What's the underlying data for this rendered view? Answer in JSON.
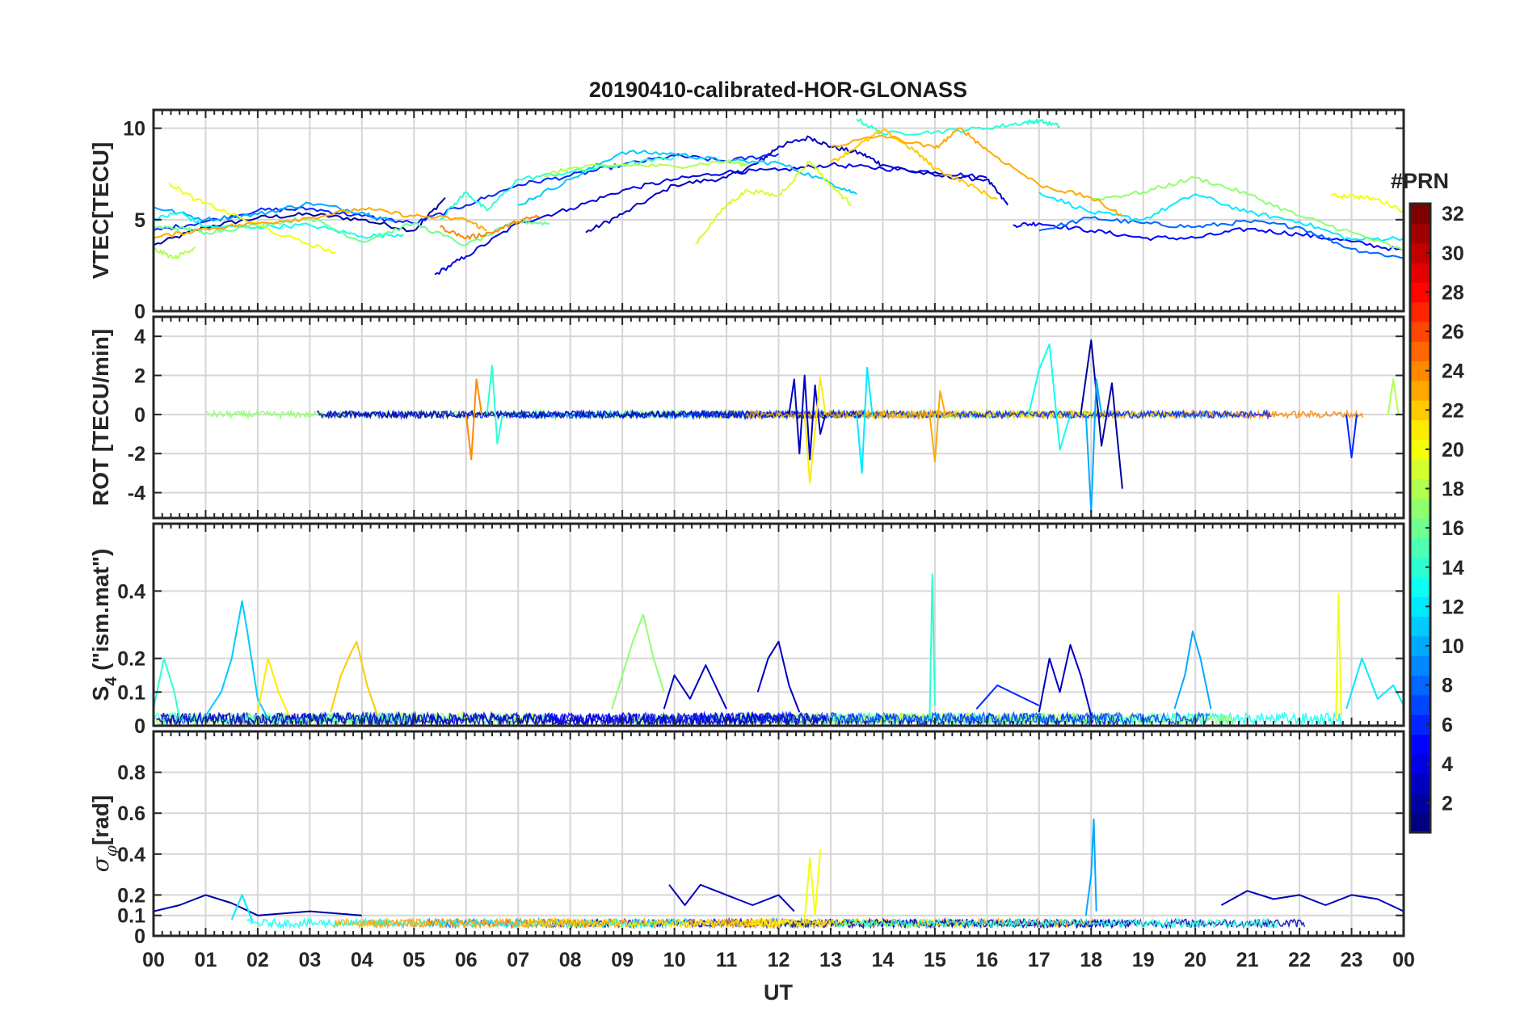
{
  "figure": {
    "title": "20190410-calibrated-HOR-GLONASS",
    "xlabel": "UT",
    "x_tick_labels": [
      "00",
      "01",
      "02",
      "03",
      "04",
      "05",
      "06",
      "07",
      "08",
      "09",
      "10",
      "11",
      "12",
      "13",
      "14",
      "15",
      "16",
      "17",
      "18",
      "19",
      "20",
      "21",
      "22",
      "23",
      "00"
    ]
  },
  "colorbar": {
    "title": "#PRN",
    "range": [
      1,
      32
    ],
    "colormap": "jet",
    "tick_values": [
      2,
      4,
      6,
      8,
      10,
      12,
      14,
      16,
      18,
      20,
      22,
      24,
      26,
      28,
      30,
      32
    ],
    "tick_labels": [
      "2",
      "4",
      "6",
      "8",
      "10",
      "12",
      "14",
      "16",
      "18",
      "20",
      "22",
      "24",
      "26",
      "28",
      "30",
      "32"
    ]
  },
  "chart_data": [
    {
      "type": "line",
      "panel": "vtec",
      "ylabel": "VTEC[TECU]",
      "xlim": [
        0,
        24
      ],
      "ylim": [
        0,
        11
      ],
      "y_ticks": [
        0,
        5,
        10
      ],
      "y_tick_labels": [
        "0",
        "5",
        "10"
      ],
      "grid": true,
      "series": [
        {
          "prn": 2,
          "x": [
            0.0,
            1.0,
            2.0,
            3.0,
            4.0,
            5.0,
            5.6
          ],
          "y": [
            3.6,
            4.6,
            5.1,
            5.3,
            5.0,
            4.4,
            6.2
          ]
        },
        {
          "prn": 3,
          "x": [
            8.3,
            9.0,
            10.0,
            11.0,
            11.6,
            12.0,
            12.6,
            13.0,
            13.6,
            14.0,
            15.0,
            16.0,
            16.4
          ],
          "y": [
            4.3,
            5.3,
            6.9,
            7.3,
            8.1,
            9.0,
            9.5,
            9.0,
            8.6,
            8.0,
            7.4,
            7.2,
            5.8
          ]
        },
        {
          "prn": 4,
          "x": [
            5.4,
            6.0,
            7.0,
            8.0,
            9.0,
            10.0,
            11.0,
            12.0,
            13.0,
            14.0,
            15.0,
            16.0
          ],
          "y": [
            2.0,
            3.0,
            4.8,
            5.6,
            6.6,
            7.2,
            7.6,
            7.7,
            8.0,
            7.8,
            7.6,
            7.3
          ]
        },
        {
          "prn": 5,
          "x": [
            16.5,
            17.0,
            18.0,
            19.0,
            20.0,
            21.0,
            22.0,
            23.0,
            24.0
          ],
          "y": [
            4.7,
            4.8,
            4.4,
            4.0,
            4.0,
            4.5,
            4.2,
            3.8,
            3.3
          ]
        },
        {
          "prn": 6,
          "x": [
            0.0,
            1.0,
            2.0,
            3.0,
            4.0,
            5.0,
            6.0,
            7.0,
            8.0,
            9.0,
            10.0,
            11.0,
            12.0
          ],
          "y": [
            4.4,
            4.9,
            5.5,
            5.6,
            5.2,
            4.8,
            5.8,
            6.9,
            7.4,
            8.0,
            8.5,
            8.2,
            8.6
          ]
        },
        {
          "prn": 8,
          "x": [
            17.0,
            18.0,
            19.0,
            20.0,
            21.0,
            22.0,
            23.0,
            24.0
          ],
          "y": [
            4.4,
            5.1,
            4.8,
            4.6,
            4.9,
            4.6,
            3.4,
            2.9
          ]
        },
        {
          "prn": 10,
          "x": [
            0.0,
            1.0,
            2.0,
            3.0,
            4.0,
            4.6
          ],
          "y": [
            5.7,
            5.0,
            5.3,
            5.9,
            5.4,
            4.9
          ]
        },
        {
          "prn": 11,
          "x": [
            7.0,
            8.0,
            9.0,
            10.0,
            11.0,
            12.0,
            13.0,
            13.5
          ],
          "y": [
            5.8,
            7.2,
            8.7,
            8.6,
            8.2,
            8.1,
            7.0,
            6.4
          ]
        },
        {
          "prn": 12,
          "x": [
            17.0,
            18.0,
            19.0,
            20.0,
            21.0,
            22.0,
            23.0,
            24.0
          ],
          "y": [
            6.5,
            5.4,
            5.0,
            6.4,
            5.4,
            4.9,
            3.9,
            4.0
          ]
        },
        {
          "prn": 13,
          "x": [
            0.0,
            0.5,
            1.0,
            2.0,
            3.0,
            4.0,
            4.8
          ],
          "y": [
            5.0,
            5.4,
            4.6,
            4.6,
            4.7,
            4.1,
            4.2
          ]
        },
        {
          "prn": 14,
          "x": [
            5.5,
            6.0,
            6.4,
            7.0,
            8.0,
            9.0,
            10.0
          ],
          "y": [
            5.0,
            6.5,
            5.5,
            7.2,
            7.6,
            8.0,
            8.4
          ]
        },
        {
          "prn": 14,
          "x": [
            13.5,
            14.0,
            15.0,
            16.0,
            16.7,
            17.0,
            17.4
          ],
          "y": [
            10.5,
            9.7,
            9.8,
            10.0,
            10.3,
            10.4,
            10.1
          ]
        },
        {
          "prn": 16,
          "x": [
            0.0,
            0.6,
            1.0,
            2.0,
            3.0,
            4.0,
            5.0,
            6.0,
            7.0,
            7.6
          ],
          "y": [
            4.6,
            4.5,
            4.3,
            4.7,
            5.1,
            3.8,
            4.8,
            3.6,
            4.9,
            4.8
          ]
        },
        {
          "prn": 17,
          "x": [
            18.0,
            19.0,
            20.0,
            21.0,
            22.0,
            23.0,
            24.0
          ],
          "y": [
            6.1,
            6.5,
            7.3,
            6.4,
            5.2,
            4.3,
            3.3
          ]
        },
        {
          "prn": 18,
          "x": [
            0.0,
            0.4,
            0.8
          ],
          "y": [
            3.4,
            2.9,
            3.5
          ]
        },
        {
          "prn": 18,
          "x": [
            7.5,
            8.0,
            9.0,
            10.0,
            11.0,
            11.4
          ],
          "y": [
            7.4,
            7.8,
            8.0,
            7.9,
            8.2,
            8.0
          ]
        },
        {
          "prn": 19,
          "x": [
            10.4,
            11.0,
            11.4,
            12.0,
            12.6,
            13.0,
            13.4
          ],
          "y": [
            3.7,
            5.8,
            6.6,
            6.3,
            8.2,
            6.9,
            5.8
          ]
        },
        {
          "prn": 20,
          "x": [
            0.3,
            0.8,
            1.5,
            2.5,
            3.5
          ],
          "y": [
            7.0,
            6.1,
            5.3,
            4.1,
            3.2
          ]
        },
        {
          "prn": 20,
          "x": [
            22.6,
            23.0,
            23.5,
            24.0
          ],
          "y": [
            6.3,
            6.3,
            6.1,
            5.5
          ]
        },
        {
          "prn": 22,
          "x": [
            13.0,
            13.5,
            14.0,
            14.6,
            15.0,
            15.6,
            16.2
          ],
          "y": [
            8.1,
            9.0,
            9.9,
            8.8,
            7.8,
            7.0,
            6.1
          ]
        },
        {
          "prn": 23,
          "x": [
            0.0,
            1.0,
            2.0,
            3.0,
            4.0,
            5.0,
            6.0,
            6.4
          ],
          "y": [
            4.0,
            4.5,
            4.8,
            5.1,
            5.6,
            5.2,
            5.0,
            4.4
          ]
        },
        {
          "prn": 23,
          "x": [
            13.0,
            14.0,
            15.0,
            15.5,
            16.0,
            17.0,
            18.0,
            18.6
          ],
          "y": [
            9.0,
            9.6,
            8.9,
            10.0,
            8.8,
            6.9,
            6.2,
            5.2
          ]
        },
        {
          "prn": 24,
          "x": [
            5.5,
            6.0,
            6.5,
            7.0,
            7.4
          ],
          "y": [
            4.6,
            4.0,
            4.3,
            4.9,
            5.2
          ]
        }
      ]
    },
    {
      "type": "line",
      "panel": "rot",
      "ylabel": "ROT [TECU/min]",
      "xlim": [
        0,
        24
      ],
      "ylim": [
        -5.3,
        5.0
      ],
      "y_ticks": [
        -4,
        -2,
        0,
        2,
        4
      ],
      "y_tick_labels": [
        "-4",
        "-2",
        "0",
        "2",
        "4"
      ],
      "grid": true,
      "series": [
        {
          "prn": 3,
          "x": [
            12.2,
            12.3,
            12.4,
            12.5,
            12.6,
            12.7,
            12.8,
            12.9
          ],
          "y": [
            0,
            1.8,
            -2.0,
            2.0,
            -2.3,
            1.5,
            -1.0,
            0
          ]
        },
        {
          "prn": 2,
          "x": [
            17.8,
            18.0,
            18.2,
            18.4,
            18.6
          ],
          "y": [
            0,
            3.8,
            -1.6,
            1.6,
            -3.8
          ]
        },
        {
          "prn": 10,
          "x": [
            17.9,
            18.0,
            18.1,
            18.2
          ],
          "y": [
            0,
            -5.0,
            1.8,
            0
          ]
        },
        {
          "prn": 13,
          "x": [
            16.8,
            17.0,
            17.2,
            17.4,
            17.6
          ],
          "y": [
            0,
            2.3,
            3.6,
            -1.8,
            0
          ]
        },
        {
          "prn": 12,
          "x": [
            13.5,
            13.6,
            13.7,
            13.8
          ],
          "y": [
            0,
            -3.0,
            2.4,
            0
          ]
        },
        {
          "prn": 21,
          "x": [
            12.5,
            12.6,
            12.8,
            12.9
          ],
          "y": [
            0,
            -3.5,
            1.9,
            0
          ]
        },
        {
          "prn": 24,
          "x": [
            6.0,
            6.1,
            6.2,
            6.3
          ],
          "y": [
            0,
            -2.3,
            1.8,
            0
          ]
        },
        {
          "prn": 14,
          "x": [
            6.4,
            6.5,
            6.6,
            6.7
          ],
          "y": [
            0,
            2.5,
            -1.5,
            0
          ]
        },
        {
          "prn": 23,
          "x": [
            14.9,
            15.0,
            15.1,
            15.2
          ],
          "y": [
            0,
            -2.4,
            1.2,
            0
          ]
        },
        {
          "prn": 6,
          "x": [
            22.9,
            23.0,
            23.1
          ],
          "y": [
            0,
            -2.2,
            0
          ]
        },
        {
          "prn": 18,
          "x": [
            23.7,
            23.8,
            23.9
          ],
          "y": [
            0,
            1.8,
            0
          ]
        }
      ]
    },
    {
      "type": "line",
      "panel": "s4",
      "ylabel": "S4 (\"ism.mat\")",
      "xlim": [
        0,
        24
      ],
      "ylim": [
        0,
        0.6
      ],
      "y_ticks": [
        0,
        0.1,
        0.2,
        0.4
      ],
      "y_tick_labels": [
        "0",
        "0.1",
        "0.2",
        "0.4"
      ],
      "grid": true,
      "series": [
        {
          "prn": 11,
          "x": [
            1.0,
            1.3,
            1.5,
            1.7,
            1.8,
            2.0,
            2.2
          ],
          "y": [
            0.03,
            0.1,
            0.2,
            0.37,
            0.28,
            0.08,
            0.02
          ]
        },
        {
          "prn": 22,
          "x": [
            3.4,
            3.6,
            3.8,
            3.9,
            4.1,
            4.3
          ],
          "y": [
            0.04,
            0.15,
            0.22,
            0.25,
            0.12,
            0.03
          ]
        },
        {
          "prn": 17,
          "x": [
            8.8,
            9.0,
            9.2,
            9.4,
            9.6,
            9.8
          ],
          "y": [
            0.05,
            0.15,
            0.25,
            0.33,
            0.2,
            0.1
          ]
        },
        {
          "prn": 3,
          "x": [
            9.8,
            10.0,
            10.3,
            10.6,
            11.0
          ],
          "y": [
            0.05,
            0.15,
            0.08,
            0.18,
            0.05
          ]
        },
        {
          "prn": 3,
          "x": [
            11.6,
            11.8,
            12.0,
            12.2,
            12.4
          ],
          "y": [
            0.1,
            0.2,
            0.25,
            0.12,
            0.04
          ]
        },
        {
          "prn": 3,
          "x": [
            17.0,
            17.2,
            17.4,
            17.6,
            17.8,
            18.0
          ],
          "y": [
            0.04,
            0.2,
            0.1,
            0.24,
            0.15,
            0.03
          ]
        },
        {
          "prn": 14,
          "x": [
            14.9,
            14.95,
            15.0
          ],
          "y": [
            0.02,
            0.45,
            0.06
          ]
        },
        {
          "prn": 10,
          "x": [
            19.6,
            19.8,
            19.95,
            20.1,
            20.3
          ],
          "y": [
            0.05,
            0.15,
            0.28,
            0.2,
            0.05
          ]
        },
        {
          "prn": 20,
          "x": [
            22.7,
            22.75,
            22.8
          ],
          "y": [
            0.02,
            0.39,
            0.03
          ]
        },
        {
          "prn": 12,
          "x": [
            22.9,
            23.2,
            23.5,
            23.8,
            24.0
          ],
          "y": [
            0.05,
            0.2,
            0.08,
            0.12,
            0.06
          ]
        },
        {
          "prn": 21,
          "x": [
            2.0,
            2.2,
            2.4,
            2.6
          ],
          "y": [
            0.04,
            0.2,
            0.1,
            0.03
          ]
        },
        {
          "prn": 14,
          "x": [
            0.0,
            0.2,
            0.4,
            0.5
          ],
          "y": [
            0.05,
            0.2,
            0.1,
            0.02
          ]
        },
        {
          "prn": 6,
          "x": [
            15.8,
            16.2,
            16.6,
            17.0
          ],
          "y": [
            0.05,
            0.12,
            0.09,
            0.06
          ]
        }
      ]
    },
    {
      "type": "line",
      "panel": "sigma_phi",
      "ylabel": "σφ[rad]",
      "xlim": [
        0,
        24
      ],
      "ylim": [
        0,
        1.0
      ],
      "y_ticks": [
        0,
        0.1,
        0.2,
        0.4,
        0.6,
        0.8
      ],
      "y_tick_labels": [
        "0",
        "0.1",
        "0.2",
        "0.4",
        "0.6",
        "0.8"
      ],
      "grid": true,
      "series": [
        {
          "prn": 2,
          "x": [
            0.0,
            0.5,
            1.0,
            1.5,
            2.0,
            3.0,
            4.0
          ],
          "y": [
            0.12,
            0.15,
            0.2,
            0.16,
            0.1,
            0.12,
            0.1
          ]
        },
        {
          "prn": 3,
          "x": [
            9.9,
            10.2,
            10.5,
            11.0,
            11.5,
            12.0,
            12.3
          ],
          "y": [
            0.25,
            0.15,
            0.25,
            0.2,
            0.15,
            0.2,
            0.12
          ]
        },
        {
          "prn": 3,
          "x": [
            20.5,
            21.0,
            21.5,
            22.0,
            22.5,
            23.0,
            23.5,
            24.0
          ],
          "y": [
            0.15,
            0.22,
            0.18,
            0.2,
            0.15,
            0.2,
            0.18,
            0.12
          ]
        },
        {
          "prn": 20,
          "x": [
            12.5,
            12.6,
            12.7,
            12.8
          ],
          "y": [
            0.08,
            0.38,
            0.1,
            0.42
          ]
        },
        {
          "prn": 10,
          "x": [
            17.9,
            18.0,
            18.05,
            18.1
          ],
          "y": [
            0.1,
            0.3,
            0.57,
            0.12
          ]
        },
        {
          "prn": 12,
          "x": [
            1.5,
            1.7,
            1.9
          ],
          "y": [
            0.08,
            0.2,
            0.07
          ]
        }
      ]
    }
  ]
}
